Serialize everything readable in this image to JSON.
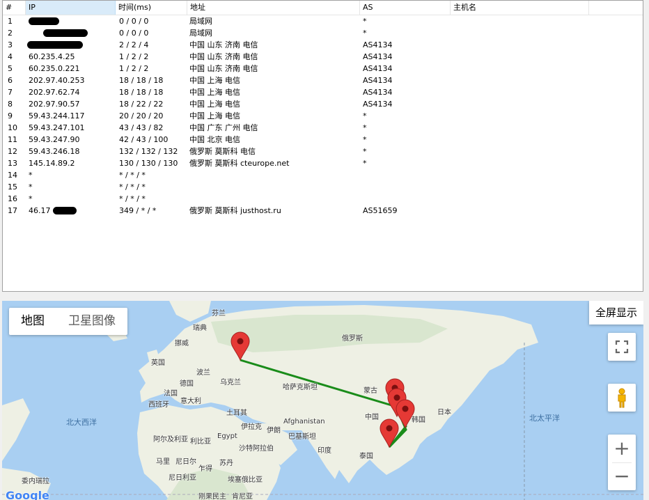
{
  "table": {
    "columns": [
      "#",
      "IP",
      "时间(ms)",
      "地址",
      "AS",
      "主机名"
    ],
    "rows": [
      {
        "idx": "1",
        "ip": "",
        "time": "0 / 0 / 0",
        "addr": "局域网",
        "as": "*"
      },
      {
        "idx": "2",
        "ip": "",
        "time": "0 / 0 / 0",
        "addr": "局域网",
        "as": "*"
      },
      {
        "idx": "3",
        "ip": "",
        "time": "2 / 2 / 4",
        "addr": "中国 山东 济南 电信",
        "as": "AS4134"
      },
      {
        "idx": "4",
        "ip": "60.235.4.25",
        "time": "1 / 2 / 2",
        "addr": "中国 山东 济南 电信",
        "as": "AS4134"
      },
      {
        "idx": "5",
        "ip": "60.235.0.221",
        "time": "1 / 2 / 2",
        "addr": "中国 山东 济南 电信",
        "as": "AS4134"
      },
      {
        "idx": "6",
        "ip": "202.97.40.253",
        "time": "18 / 18 / 18",
        "addr": "中国 上海 电信",
        "as": "AS4134"
      },
      {
        "idx": "7",
        "ip": "202.97.62.74",
        "time": "18 / 18 / 18",
        "addr": "中国 上海 电信",
        "as": "AS4134"
      },
      {
        "idx": "8",
        "ip": "202.97.90.57",
        "time": "18 / 22 / 22",
        "addr": "中国 上海 电信",
        "as": "AS4134"
      },
      {
        "idx": "9",
        "ip": "59.43.244.117",
        "time": "20 / 20 / 20",
        "addr": "中国 上海 电信",
        "as": "*"
      },
      {
        "idx": "10",
        "ip": "59.43.247.101",
        "time": "43 / 43 / 82",
        "addr": "中国 广东 广州 电信",
        "as": "*"
      },
      {
        "idx": "11",
        "ip": "59.43.247.90",
        "time": "42 / 43 / 100",
        "addr": "中国 北京 电信",
        "as": "*"
      },
      {
        "idx": "12",
        "ip": "59.43.246.18",
        "time": "132 / 132 / 132",
        "addr": "俄罗斯 莫斯科 电信",
        "as": "*"
      },
      {
        "idx": "13",
        "ip": "145.14.89.2",
        "time": "130 / 130 / 130",
        "addr": "俄罗斯 莫斯科 cteurope.net",
        "as": "*"
      },
      {
        "idx": "14",
        "ip": "*",
        "time": "* / * / *",
        "addr": "",
        "as": ""
      },
      {
        "idx": "15",
        "ip": "*",
        "time": "* / * / *",
        "addr": "",
        "as": ""
      },
      {
        "idx": "16",
        "ip": "*",
        "time": "* / * / *",
        "addr": "",
        "as": ""
      },
      {
        "idx": "17",
        "ip": "46.17",
        "time": "349 / * / *",
        "addr": "俄罗斯 莫斯科 justhost.ru",
        "as": "AS51659"
      }
    ]
  },
  "map": {
    "type_buttons": {
      "map": "地图",
      "satellite": "卫星图像"
    },
    "fullscreen_label": "全屏显示",
    "zoom_in": "+",
    "zoom_out": "−",
    "logo": "Google",
    "labels": {
      "finland": "芬兰",
      "sweden": "瑞典",
      "norway": "挪威",
      "uk": "英国",
      "poland": "波兰",
      "germany": "德国",
      "ukraine": "乌克兰",
      "france": "法国",
      "italy": "意大利",
      "spain": "西班牙",
      "russia": "俄罗斯",
      "kazakhstan": "哈萨克斯坦",
      "mongolia": "蒙古",
      "china": "中国",
      "korea": "韩国",
      "japan": "日本",
      "turkey": "土耳其",
      "iraq": "伊拉克",
      "iran": "伊朗",
      "afghanistan": "Afghanistan",
      "pakistan": "巴基斯坦",
      "india": "印度",
      "thailand": "泰国",
      "algeria": "阿尔及利亚",
      "libya": "利比亚",
      "egypt": "Egypt",
      "saudi": "沙特阿拉伯",
      "mali": "马里",
      "niger": "尼日尔",
      "chad": "乍得",
      "sudan": "苏丹",
      "nigeria": "尼日利亚",
      "ethiopia": "埃塞俄比亚",
      "venezuela": "委内瑞拉",
      "congo": "刚果民主",
      "kenya": "肯尼亚",
      "north_atlantic": "北大西洋",
      "north_pacific": "北太平洋"
    },
    "colors": {
      "route": "#1a8c1a",
      "marker": "#e53935",
      "water": "#a9cff2",
      "land": "#eef0e4"
    }
  }
}
